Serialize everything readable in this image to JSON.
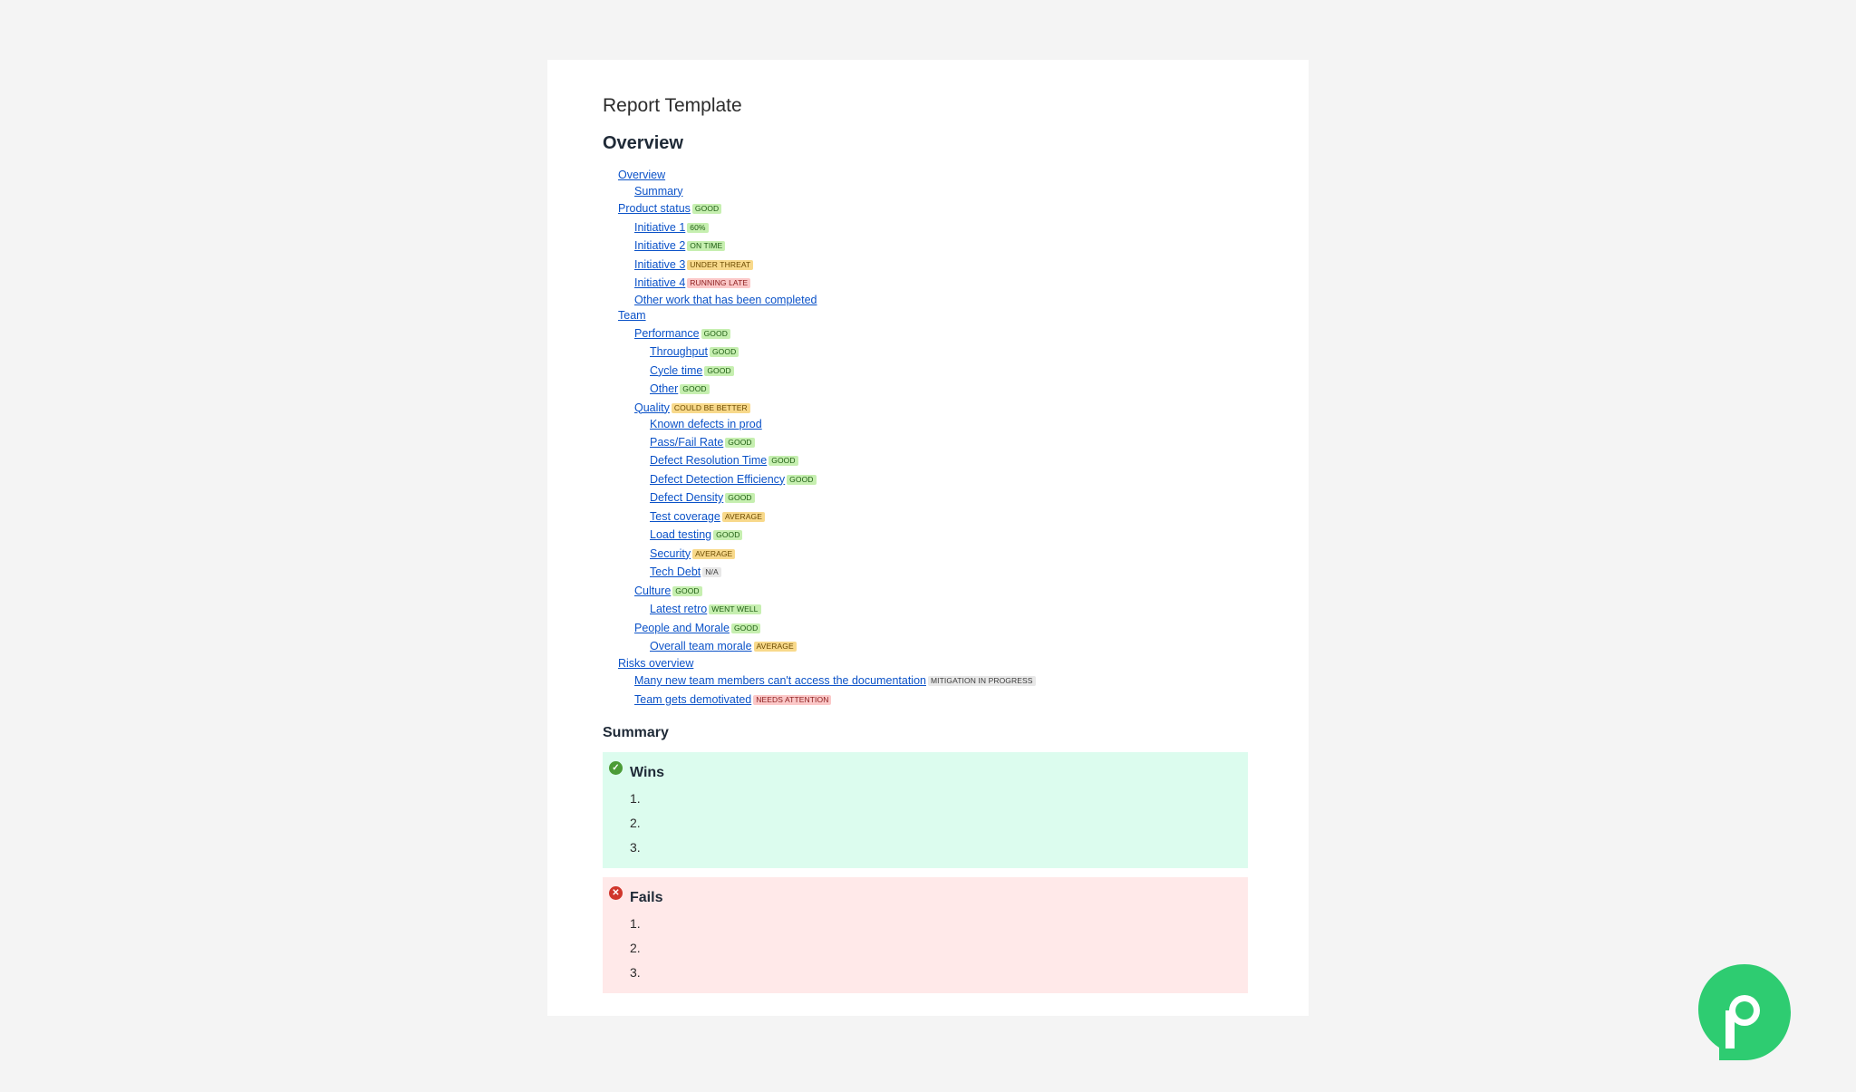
{
  "document": {
    "title": "Report Template",
    "overview_heading": "Overview",
    "summary_heading": "Summary"
  },
  "toc": [
    {
      "level": 1,
      "label": "Overview",
      "status": null,
      "tone": null
    },
    {
      "level": 2,
      "label": "Summary",
      "status": null,
      "tone": null
    },
    {
      "level": 1,
      "label": "Product status",
      "status": "GOOD",
      "tone": "green"
    },
    {
      "level": 2,
      "label": "Initiative 1",
      "status": "60%",
      "tone": "green"
    },
    {
      "level": 2,
      "label": "Initiative 2",
      "status": "ON TIME",
      "tone": "green"
    },
    {
      "level": 2,
      "label": "Initiative 3",
      "status": "UNDER THREAT",
      "tone": "yellow"
    },
    {
      "level": 2,
      "label": "Initiative 4",
      "status": "RUNNING LATE",
      "tone": "red"
    },
    {
      "level": 2,
      "label": "Other work that has been completed",
      "status": null,
      "tone": null
    },
    {
      "level": 1,
      "label": "Team",
      "status": null,
      "tone": null
    },
    {
      "level": 2,
      "label": "Performance",
      "status": "GOOD",
      "tone": "green"
    },
    {
      "level": 3,
      "label": "Throughput",
      "status": "GOOD",
      "tone": "green"
    },
    {
      "level": 3,
      "label": "Cycle time",
      "status": "GOOD",
      "tone": "green"
    },
    {
      "level": 3,
      "label": "Other",
      "status": "GOOD",
      "tone": "green"
    },
    {
      "level": 2,
      "label": "Quality",
      "status": "COULD BE BETTER",
      "tone": "yellow"
    },
    {
      "level": 3,
      "label": "Known defects in prod",
      "status": null,
      "tone": null
    },
    {
      "level": 3,
      "label": "Pass/Fail Rate",
      "status": "GOOD",
      "tone": "green"
    },
    {
      "level": 3,
      "label": "Defect Resolution Time",
      "status": "GOOD",
      "tone": "green"
    },
    {
      "level": 3,
      "label": "Defect Detection Efficiency",
      "status": "GOOD",
      "tone": "green"
    },
    {
      "level": 3,
      "label": "Defect Density",
      "status": "GOOD",
      "tone": "green"
    },
    {
      "level": 3,
      "label": "Test coverage",
      "status": "AVERAGE",
      "tone": "yellow"
    },
    {
      "level": 3,
      "label": "Load testing",
      "status": "GOOD",
      "tone": "green"
    },
    {
      "level": 3,
      "label": "Security",
      "status": "AVERAGE",
      "tone": "yellow"
    },
    {
      "level": 3,
      "label": "Tech Debt",
      "status": "N/A",
      "tone": "grey"
    },
    {
      "level": 2,
      "label": "Culture",
      "status": "GOOD",
      "tone": "green"
    },
    {
      "level": 3,
      "label": "Latest retro",
      "status": "WENT WELL",
      "tone": "green"
    },
    {
      "level": 2,
      "label": "People and Morale",
      "status": "GOOD",
      "tone": "green"
    },
    {
      "level": 3,
      "label": "Overall team morale",
      "status": "AVERAGE",
      "tone": "yellow"
    },
    {
      "level": 1,
      "label": "Risks overview",
      "status": null,
      "tone": null
    },
    {
      "level": 2,
      "label": "Many new team members can't access the documentation",
      "status": "MITIGATION IN PROGRESS",
      "tone": "grey"
    },
    {
      "level": 2,
      "label": "Team gets demotivated",
      "status": "NEEDS ATTENTION",
      "tone": "red"
    }
  ],
  "wins": {
    "title": "Wins",
    "icon": "check-circle-icon",
    "items": [
      "1.",
      "2.",
      "3."
    ]
  },
  "fails": {
    "title": "Fails",
    "icon": "x-circle-icon",
    "items": [
      "1.",
      "2.",
      "3."
    ]
  },
  "colors": {
    "link": "#0b52c8",
    "wins_bg": "#dcfcee",
    "fails_bg": "#ffe9e9",
    "logo": "#2ecc71"
  },
  "logo": {
    "icon": "p-logo-icon"
  }
}
